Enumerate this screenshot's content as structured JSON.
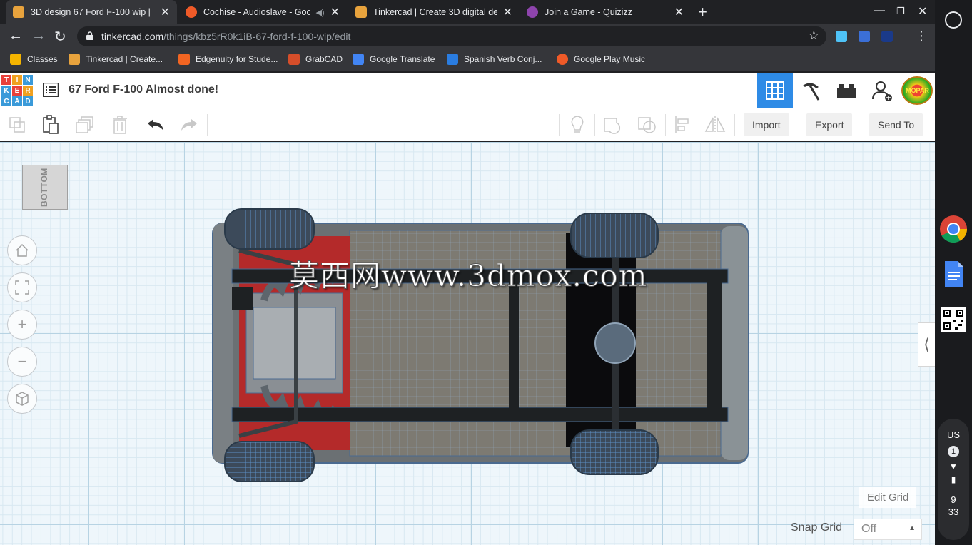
{
  "tabs": [
    {
      "title": "3D design 67 Ford F-100 wip | Ti",
      "favicon_color": "#e8a33d",
      "active": true
    },
    {
      "title": "Cochise - Audioslave - Goog",
      "favicon_color": "#ef5a28",
      "active": false
    },
    {
      "title": "Tinkercad | Create 3D digital des",
      "favicon_color": "#e8a33d",
      "active": false
    },
    {
      "title": "Join a Game - Quizizz",
      "favicon_color": "#8e44ad",
      "active": false
    }
  ],
  "address": {
    "host": "tinkercad.com",
    "path": "/things/kbz5rR0k1iB-67-ford-f-100-wip/edit"
  },
  "bookmarks": [
    {
      "label": "Classes",
      "color": "#f4b400"
    },
    {
      "label": "Tinkercad | Create...",
      "color": "#e8a33d"
    },
    {
      "label": "Edgenuity for Stude...",
      "color": "#f26522"
    },
    {
      "label": "GrabCAD",
      "color": "#d64e2a"
    },
    {
      "label": "Google Translate",
      "color": "#4285f4"
    },
    {
      "label": "Spanish Verb Conj...",
      "color": "#2a7de1"
    },
    {
      "label": "Google Play Music",
      "color": "#ef5a28"
    }
  ],
  "logo": {
    "letters": [
      "T",
      "I",
      "N",
      "K",
      "E",
      "R",
      "C",
      "A",
      "D"
    ]
  },
  "design_title": "67 Ford F-100 Almost done!",
  "toolbar": {
    "import_label": "Import",
    "export_label": "Export",
    "sendto_label": "Send To"
  },
  "viewcube_label": "BOTTOM",
  "watermark": "莫西网www.3dmox.com",
  "avatar_text": "MOPAR",
  "edit_grid_label": "Edit Grid",
  "snap_grid": {
    "label": "Snap Grid",
    "value": "Off"
  },
  "tray": {
    "lang": "US",
    "notifications": "1",
    "time_hour": "9",
    "time_min": "33"
  },
  "colors": {
    "accent": "#2e8be6",
    "grid_bg": "#eef6fb",
    "chrome_dark": "#35363a"
  }
}
